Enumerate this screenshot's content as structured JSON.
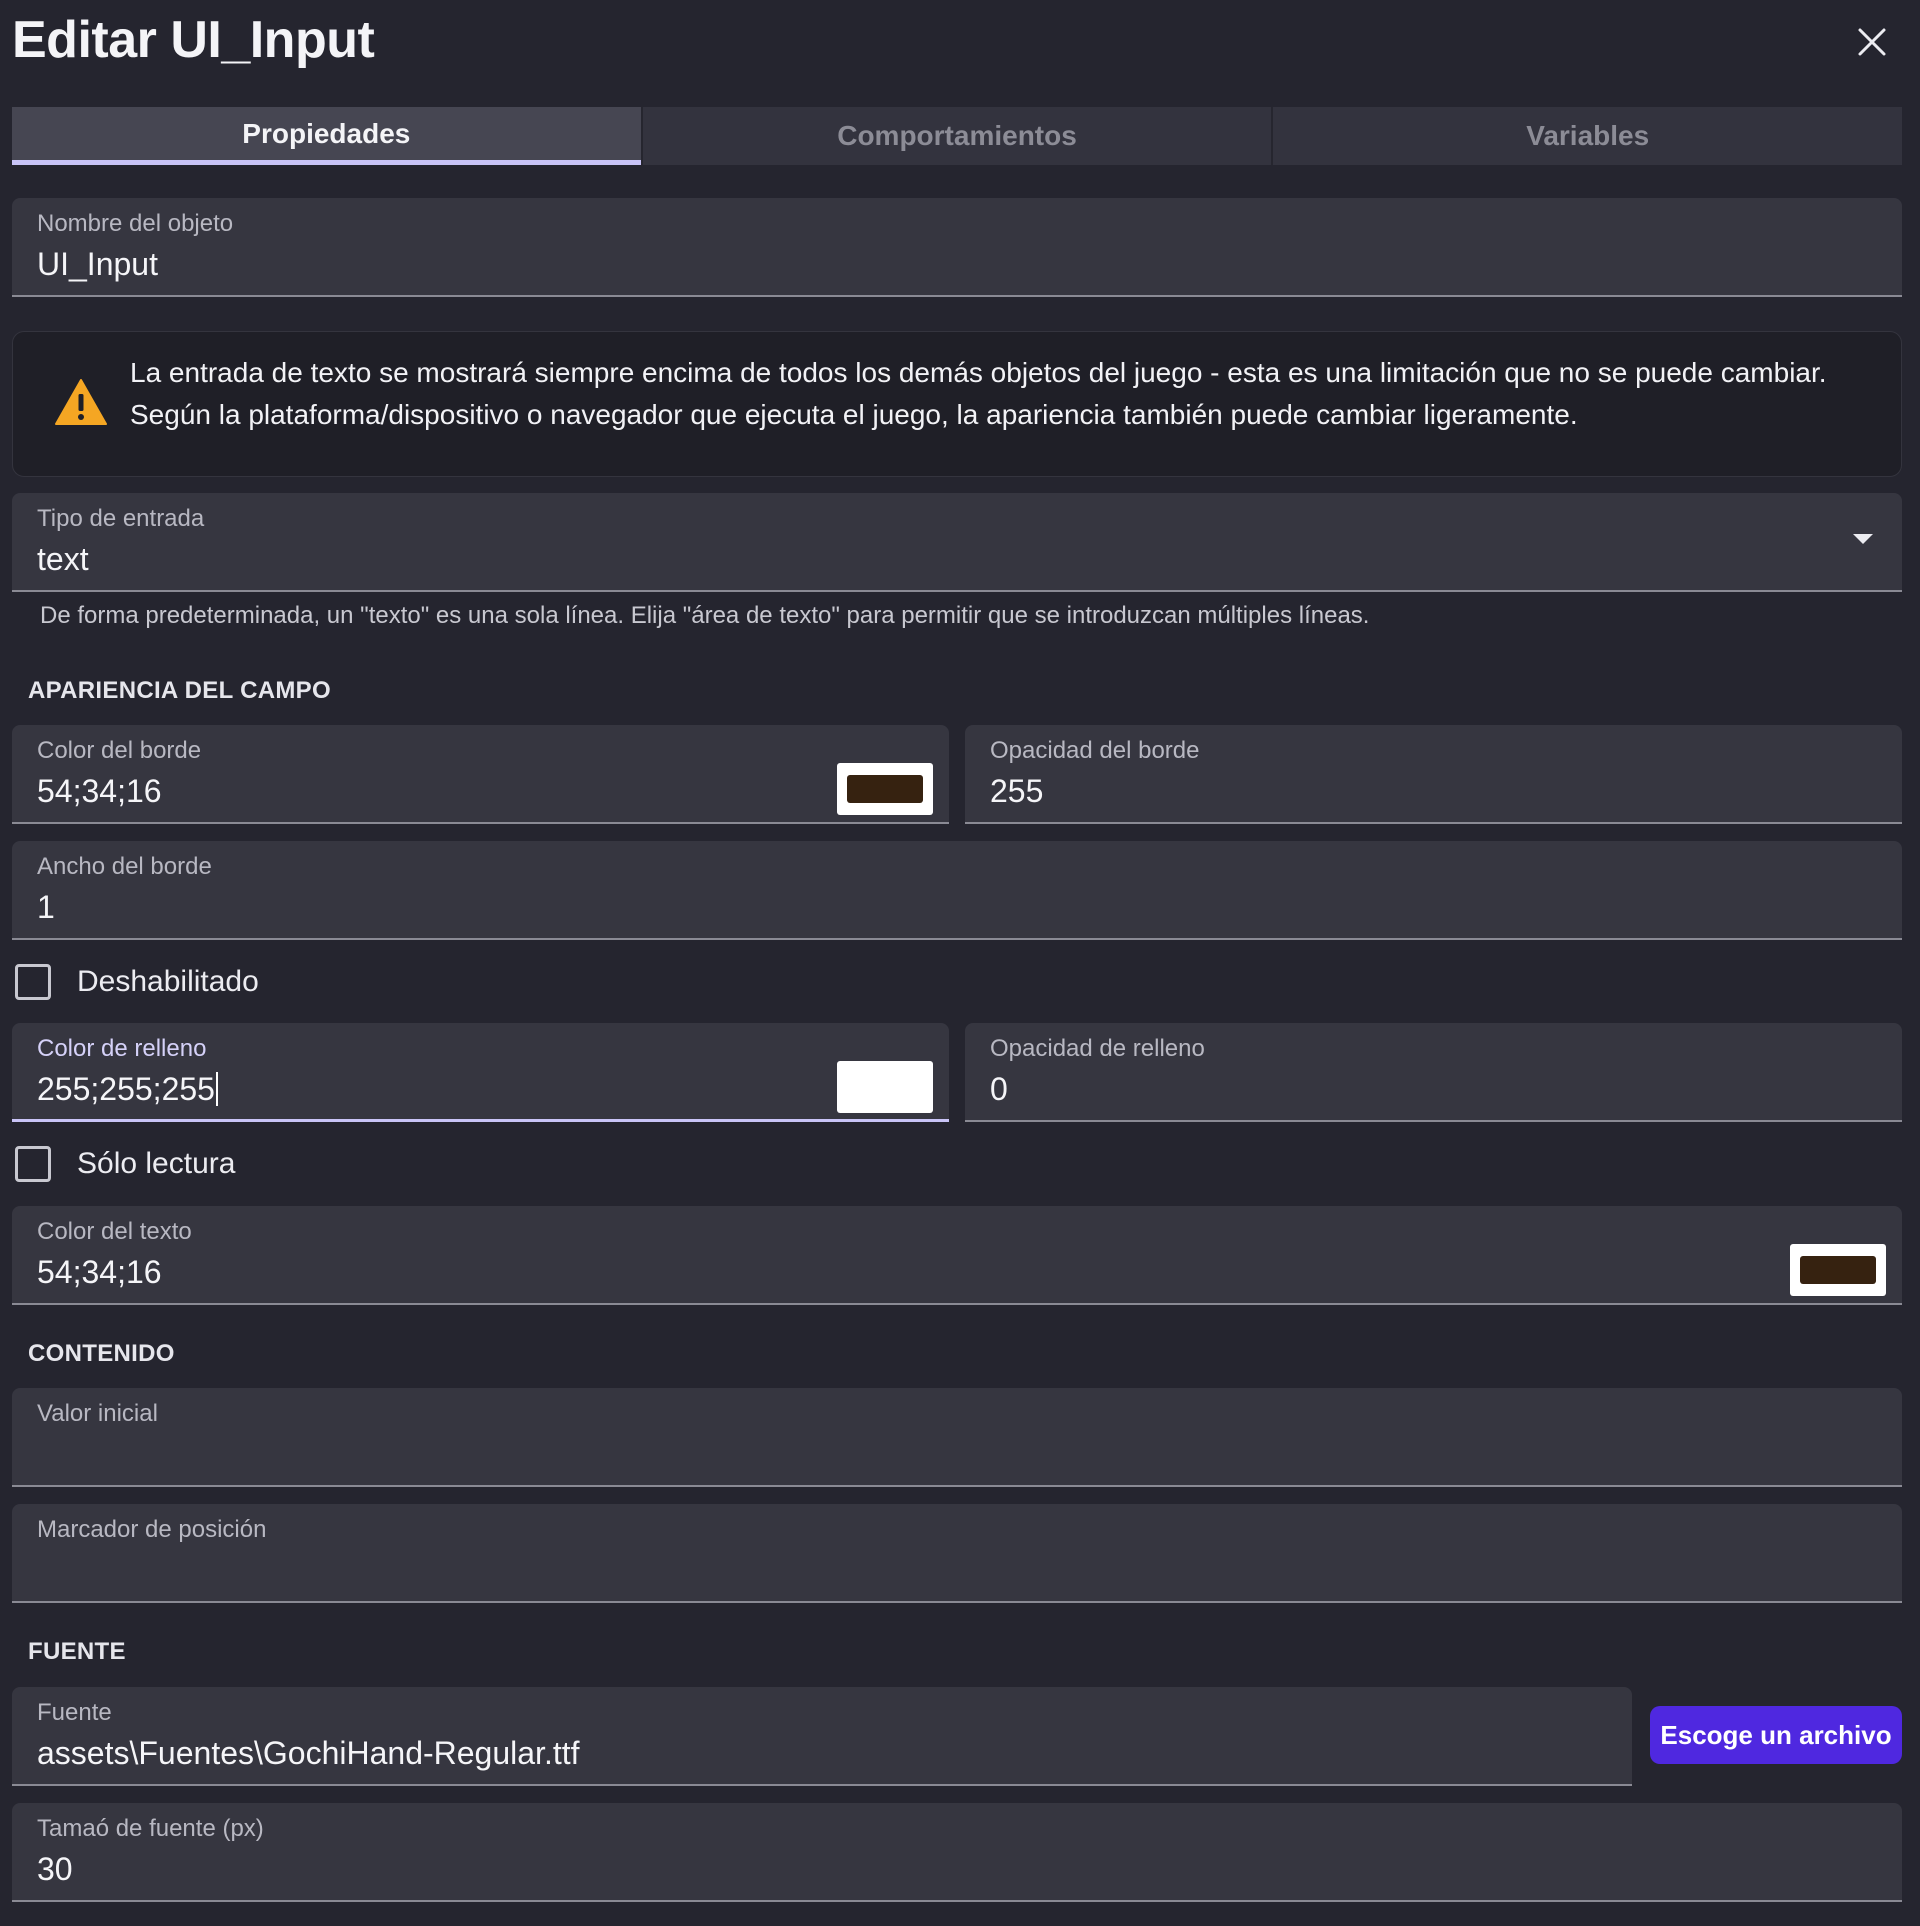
{
  "dialog": {
    "title": "Editar UI_Input"
  },
  "tabs": [
    {
      "label": "Propiedades",
      "active": true
    },
    {
      "label": "Comportamientos",
      "active": false
    },
    {
      "label": "Variables",
      "active": false
    }
  ],
  "object_name": {
    "label": "Nombre del objeto",
    "value": "UI_Input"
  },
  "warning": {
    "icon": "warning-triangle-icon",
    "text": "La entrada de texto se mostrará siempre encima de todos los demás objetos del juego - esta es una limitación que no se puede cambiar. Según la plataforma/dispositivo o navegador que ejecuta el juego, la apariencia también puede cambiar ligeramente."
  },
  "input_type": {
    "label": "Tipo de entrada",
    "value": "text",
    "helper": "De forma predeterminada, un \"texto\" es una sola línea. Elija \"área de texto\" para permitir que se introduzcan múltiples líneas."
  },
  "appearance": {
    "section_title": "APARIENCIA DEL CAMPO",
    "border_color": {
      "label": "Color del borde",
      "value": "54;34;16",
      "swatch": "#362210"
    },
    "border_opacity": {
      "label": "Opacidad del borde",
      "value": "255"
    },
    "border_width": {
      "label": "Ancho del borde",
      "value": "1"
    },
    "disabled": {
      "label": "Deshabilitado",
      "checked": false
    },
    "fill_color": {
      "label": "Color de relleno",
      "value": "255;255;255",
      "swatch": "#ffffff"
    },
    "fill_opacity": {
      "label": "Opacidad de relleno",
      "value": "0"
    },
    "read_only": {
      "label": "Sólo lectura",
      "checked": false
    },
    "text_color": {
      "label": "Color del texto",
      "value": "54;34;16",
      "swatch": "#362210"
    }
  },
  "content": {
    "section_title": "CONTENIDO",
    "initial_value": {
      "label": "Valor inicial",
      "value": ""
    },
    "placeholder": {
      "label": "Marcador de posición",
      "value": ""
    }
  },
  "font": {
    "section_title": "FUENTE",
    "font_file": {
      "label": "Fuente",
      "value": "assets\\Fuentes\\GochiHand-Regular.ttf"
    },
    "choose_button": "Escoge un archivo",
    "font_size": {
      "label": "Tamaó de fuente (px)",
      "value": "30"
    }
  },
  "colors": {
    "accent": "#4f28e0",
    "tab_indicator": "#c9c4f7",
    "background": "#25252f",
    "field": "#363640",
    "warning": "#f5a623"
  }
}
